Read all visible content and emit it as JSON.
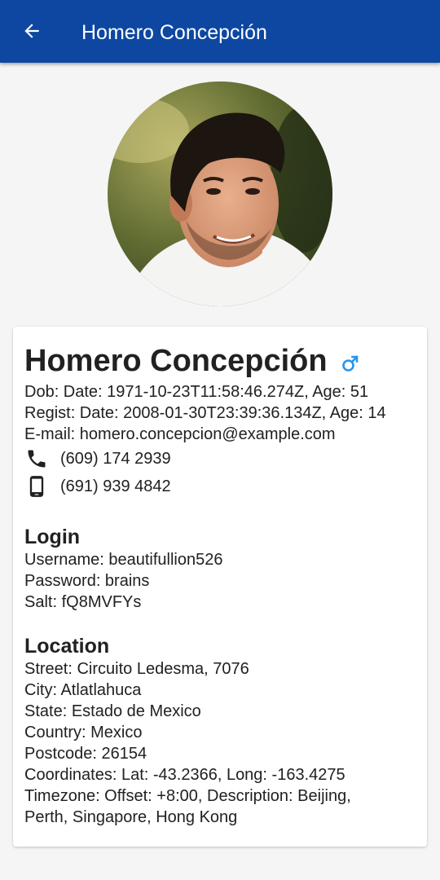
{
  "appbar": {
    "title": "Homero Concepción",
    "color": "#0d47a1"
  },
  "profile": {
    "name": "Homero Concepción",
    "gender_icon": "male-icon",
    "gender_color": "#2196f3",
    "dob": "Dob: Date: 1971-10-23T11:58:46.274Z, Age: 51",
    "registered": "Regist: Date: 2008-01-30T23:39:36.134Z, Age: 14",
    "email": "E-mail: homero.concepcion@example.com",
    "phone": "(609) 174 2939",
    "cell": "(691) 939 4842"
  },
  "login": {
    "title": "Login",
    "username": "Username: beautifullion526",
    "password": "Password: brains",
    "salt": "Salt: fQ8MVFYs"
  },
  "location": {
    "title": "Location",
    "street": "Street: Circuito Ledesma, 7076",
    "city": "City: Atlatlahuca",
    "state": "State: Estado de Mexico",
    "country": "Country: Mexico",
    "postcode": "Postcode: 26154",
    "coordinates": "Coordinates: Lat: -43.2366, Long: -163.4275",
    "timezone_line1": "Timezone: Offset: +8:00, Description: Beijing,",
    "timezone_line2": "Perth, Singapore, Hong Kong"
  }
}
